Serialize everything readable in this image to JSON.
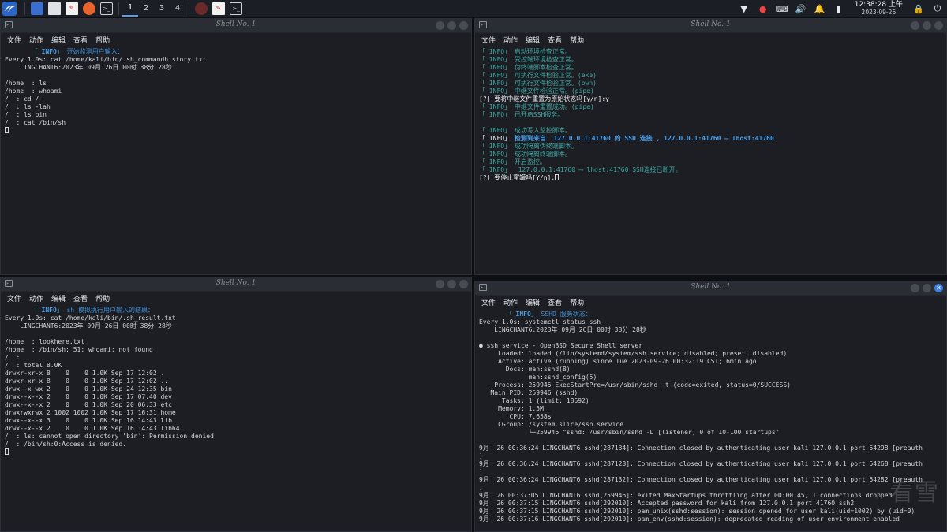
{
  "taskbar": {
    "workspaces": [
      "1",
      "2",
      "3",
      "4"
    ],
    "clock_time": "12:38:28 上午",
    "clock_date": "2023-09-26"
  },
  "menus": [
    "文件",
    "动作",
    "编辑",
    "查看",
    "帮助"
  ],
  "windows": [
    {
      "title": "Shell No. 1",
      "lines": [
        [
          {
            "t": "       「 ",
            "c": "c-teal"
          },
          {
            "t": "INFO",
            "c": "c-blue-b"
          },
          {
            "t": "」",
            "c": "c-teal"
          },
          {
            "t": " 开始监测用户输入：",
            "c": "c-blue"
          }
        ],
        [
          {
            "t": "Every 1.0s: cat /home/kali/bin/.sh_commandhistory.txt",
            "c": "c-white"
          }
        ],
        [
          {
            "t": "    LINGCHANT6:2023年 09月 26日 00时 38分 28秒",
            "c": "c-white"
          }
        ],
        [
          {
            "t": "",
            "c": "c-white"
          }
        ],
        [
          {
            "t": "/home  : ls",
            "c": "c-white"
          }
        ],
        [
          {
            "t": "/home  : whoami",
            "c": "c-white"
          }
        ],
        [
          {
            "t": "/  : cd /",
            "c": "c-white"
          }
        ],
        [
          {
            "t": "/  : ls -lah",
            "c": "c-white"
          }
        ],
        [
          {
            "t": "/  : ls bin",
            "c": "c-white"
          }
        ],
        [
          {
            "t": "/  : cat /bin/sh",
            "c": "c-white"
          }
        ]
      ]
    },
    {
      "title": "Shell No. 1",
      "lines": [
        [
          {
            "t": "「 INFO」 启动环境检查正常。",
            "c": "c-teal"
          }
        ],
        [
          {
            "t": "「 INFO」 受控端环境检查正常。",
            "c": "c-teal"
          }
        ],
        [
          {
            "t": "「 INFO」 伪终端脚本检查正常。",
            "c": "c-teal"
          }
        ],
        [
          {
            "t": "「 INFO」 可执行文件检验正常。(exe)",
            "c": "c-teal"
          }
        ],
        [
          {
            "t": "「 INFO」 可执行文件检验正常。(own)",
            "c": "c-teal"
          }
        ],
        [
          {
            "t": "「 INFO」 中继文件检验正常。(pipe)",
            "c": "c-teal"
          }
        ],
        [
          {
            "t": "[?] 要将中继文件重置为原始状态吗[y/n]:y",
            "c": "c-bright"
          }
        ],
        [
          {
            "t": "「 INFO」 中继文件重置成功。(pipe)",
            "c": "c-teal"
          }
        ],
        [
          {
            "t": "「 INFO」 已开启SSH服务。",
            "c": "c-teal"
          }
        ],
        [
          {
            "t": "",
            "c": "c-white"
          }
        ],
        [
          {
            "t": "「 INFO」 成功写入监控脚本。",
            "c": "c-teal"
          }
        ],
        [
          {
            "t": "「 INFO」",
            "c": "c-bright"
          },
          {
            "t": " 检测到来自  127.0.0.1:41760 的 SSH 连接 , 127.0.0.1:41760 ⟶ lhost:41760",
            "c": "c-blue-b"
          }
        ],
        [
          {
            "t": "「 INFO」 成功隔离伪终端脚本。",
            "c": "c-teal"
          }
        ],
        [
          {
            "t": "「 INFO」 成功隔离终端脚本。",
            "c": "c-teal"
          }
        ],
        [
          {
            "t": "「 INFO」 开启监控。",
            "c": "c-teal"
          }
        ],
        [
          {
            "t": "「 INFO」  127.0.0.1:41760 ⟶ lhost:41760 SSH连接已断开。",
            "c": "c-teal"
          }
        ],
        [
          {
            "t": "[?] 要停止蜜罐吗[Y/n]:",
            "c": "c-bright"
          }
        ]
      ]
    },
    {
      "title": "Shell No. 1",
      "lines": [
        [
          {
            "t": "       「 ",
            "c": "c-teal"
          },
          {
            "t": "INFO",
            "c": "c-blue-b"
          },
          {
            "t": "」",
            "c": "c-teal"
          },
          {
            "t": " sh 模拟执行用户输入的结果：",
            "c": "c-blue"
          }
        ],
        [
          {
            "t": "Every 1.0s: cat /home/kali/bin/.sh_result.txt",
            "c": "c-white"
          }
        ],
        [
          {
            "t": "    LINGCHANT6:2023年 09月 26日 00时 38分 28秒",
            "c": "c-white"
          }
        ],
        [
          {
            "t": "",
            "c": "c-white"
          }
        ],
        [
          {
            "t": "/home  : lookhere.txt",
            "c": "c-white"
          }
        ],
        [
          {
            "t": "/home  : /bin/sh: 51: whoami: not found",
            "c": "c-white"
          }
        ],
        [
          {
            "t": "/  :",
            "c": "c-white"
          }
        ],
        [
          {
            "t": "/  : total 8.0K",
            "c": "c-white"
          }
        ],
        [
          {
            "t": "drwxr-xr-x 8    0    0 1.0K Sep 17 12:02 .",
            "c": "c-white"
          }
        ],
        [
          {
            "t": "drwxr-xr-x 8    0    0 1.0K Sep 17 12:02 ..",
            "c": "c-white"
          }
        ],
        [
          {
            "t": "drwx--x-wx 2    0    0 1.0K Sep 24 12:35 bin",
            "c": "c-white"
          }
        ],
        [
          {
            "t": "drwx--x--x 2    0    0 1.0K Sep 17 07:40 dev",
            "c": "c-white"
          }
        ],
        [
          {
            "t": "drwx--x--x 2    0    0 1.0K Sep 20 06:33 etc",
            "c": "c-white"
          }
        ],
        [
          {
            "t": "drwxrwxrwx 2 1002 1002 1.0K Sep 17 16:31 home",
            "c": "c-white"
          }
        ],
        [
          {
            "t": "drwx--x--x 3    0    0 1.0K Sep 16 14:43 lib",
            "c": "c-white"
          }
        ],
        [
          {
            "t": "drwx--x--x 2    0    0 1.0K Sep 16 14:43 lib64",
            "c": "c-white"
          }
        ],
        [
          {
            "t": "/  : ls: cannot open directory 'bin': Permission denied",
            "c": "c-white"
          }
        ],
        [
          {
            "t": "/  : /bin/sh:0:Access is denied.",
            "c": "c-white"
          }
        ]
      ]
    },
    {
      "title": "Shell No. 1",
      "lines": [
        [
          {
            "t": "       「 ",
            "c": "c-teal"
          },
          {
            "t": "INFO",
            "c": "c-blue-b"
          },
          {
            "t": "」",
            "c": "c-teal"
          },
          {
            "t": " SSHD 服务状态：",
            "c": "c-blue"
          }
        ],
        [
          {
            "t": "Every 1.0s: systemctl status ssh",
            "c": "c-white"
          }
        ],
        [
          {
            "t": "    LINGCHANT6:2023年 09月 26日 00时 38分 28秒",
            "c": "c-white"
          }
        ],
        [
          {
            "t": "",
            "c": "c-white"
          }
        ],
        [
          {
            "t": "● ssh.service - OpenBSD Secure Shell server",
            "c": "c-white"
          }
        ],
        [
          {
            "t": "     Loaded: loaded (/lib/systemd/system/ssh.service; disabled; preset: disabled)",
            "c": "c-white"
          }
        ],
        [
          {
            "t": "     Active: active (running) since Tue 2023-09-26 00:32:19 CST; 6min ago",
            "c": "c-white"
          }
        ],
        [
          {
            "t": "       Docs: man:sshd(8)",
            "c": "c-white"
          }
        ],
        [
          {
            "t": "             man:sshd_config(5)",
            "c": "c-white"
          }
        ],
        [
          {
            "t": "    Process: 259945 ExecStartPre=/usr/sbin/sshd -t (code=exited, status=0/SUCCESS)",
            "c": "c-white"
          }
        ],
        [
          {
            "t": "   Main PID: 259946 (sshd)",
            "c": "c-white"
          }
        ],
        [
          {
            "t": "      Tasks: 1 (limit: 18692)",
            "c": "c-white"
          }
        ],
        [
          {
            "t": "     Memory: 1.5M",
            "c": "c-white"
          }
        ],
        [
          {
            "t": "        CPU: 7.658s",
            "c": "c-white"
          }
        ],
        [
          {
            "t": "     CGroup: /system.slice/ssh.service",
            "c": "c-white"
          }
        ],
        [
          {
            "t": "             └─259946 \"sshd: /usr/sbin/sshd -D [listener] 0 of 10-100 startups\"",
            "c": "c-white"
          }
        ],
        [
          {
            "t": "",
            "c": "c-white"
          }
        ],
        [
          {
            "t": "9月  26 00:36:24 LINGCHANT6 sshd[287134]: Connection closed by authenticating user kali 127.0.0.1 port 54298 [preauth",
            "c": "c-white"
          }
        ],
        [
          {
            "t": "]",
            "c": "c-white"
          }
        ],
        [
          {
            "t": "9月  26 00:36:24 LINGCHANT6 sshd[287128]: Connection closed by authenticating user kali 127.0.0.1 port 54268 [preauth",
            "c": "c-white"
          }
        ],
        [
          {
            "t": "]",
            "c": "c-white"
          }
        ],
        [
          {
            "t": "9月  26 00:36:24 LINGCHANT6 sshd[287132]: Connection closed by authenticating user kali 127.0.0.1 port 54282 [preauth",
            "c": "c-white"
          }
        ],
        [
          {
            "t": "]",
            "c": "c-white"
          }
        ],
        [
          {
            "t": "9月  26 00:37:05 LINGCHANT6 sshd[259946]: exited MaxStartups throttling after 00:00:45, 1 connections dropped",
            "c": "c-white"
          }
        ],
        [
          {
            "t": "9月  26 00:37:15 LINGCHANT6 sshd[292010]: Accepted password for kali from 127.0.0.1 port 41760 ssh2",
            "c": "c-white"
          }
        ],
        [
          {
            "t": "9月  26 00:37:15 LINGCHANT6 sshd[292010]: pam_unix(sshd:session): session opened for user kali(uid=1002) by (uid=0)",
            "c": "c-white"
          }
        ],
        [
          {
            "t": "9月  26 00:37:16 LINGCHANT6 sshd[292010]: pam_env(sshd:session): deprecated reading of user environment enabled",
            "c": "c-white"
          }
        ]
      ]
    }
  ],
  "watermark": "看雪"
}
